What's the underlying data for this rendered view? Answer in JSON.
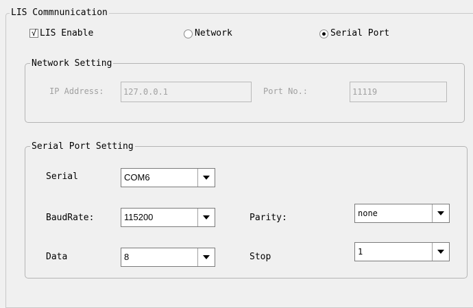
{
  "lis_communication": {
    "title": "LIS Commnunication",
    "enable": {
      "label": "LIS Enable",
      "checked": true,
      "check_mark": "√"
    },
    "connection_options": [
      {
        "label": "Network",
        "selected": false
      },
      {
        "label": "Serial Port",
        "selected": true
      }
    ]
  },
  "network_setting": {
    "title": "Network Setting",
    "ip_label": "IP Address:",
    "ip_value": "127.0.0.1",
    "port_label": "Port No.:",
    "port_value": "11119",
    "enabled": false
  },
  "serial_port_setting": {
    "title": "Serial Port Setting",
    "serial_label": "Serial",
    "serial_value": "COM6",
    "baudrate_label": "BaudRate:",
    "baudrate_value": "115200",
    "parity_label": "Parity:",
    "parity_value": "none",
    "data_label": "Data",
    "data_value": "8",
    "stop_label": "Stop",
    "stop_value": "1"
  },
  "icons": {
    "dropdown": "chevron-down-icon"
  },
  "colors": {
    "background": "#f0f0f0",
    "disabled_text": "#a0a0a0",
    "border": "#b4b4b4"
  }
}
